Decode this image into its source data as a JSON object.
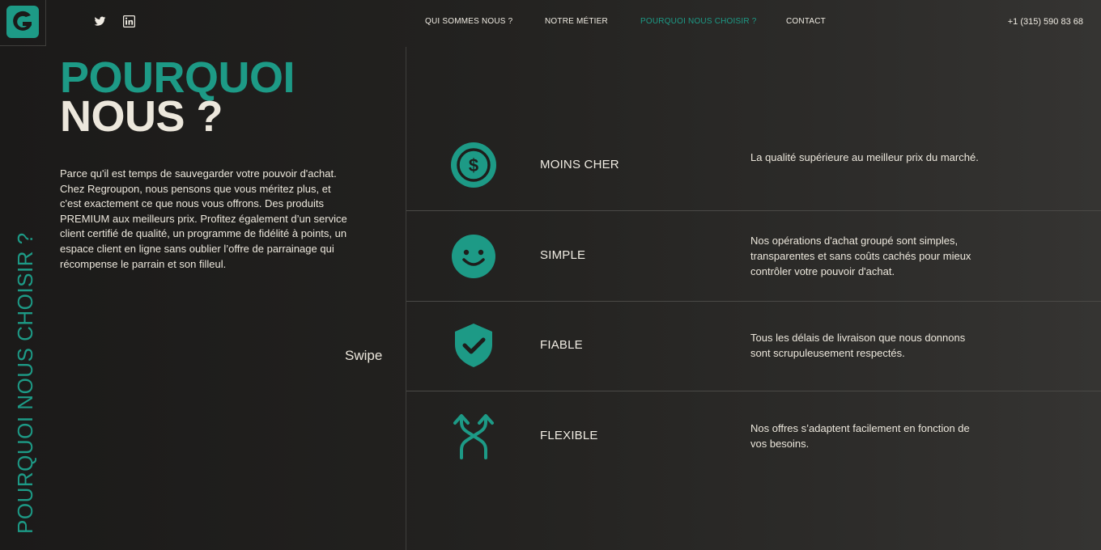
{
  "brand": {
    "logo_icon": "g-logo-icon",
    "accent_color": "#1d9a86"
  },
  "social": [
    {
      "icon": "twitter-icon"
    },
    {
      "icon": "linkedin-icon"
    }
  ],
  "nav": {
    "items": [
      {
        "label": "QUI SOMMES NOUS ?"
      },
      {
        "label": "NOTRE MÉTIER"
      },
      {
        "label": "POURQUOI NOUS CHOISIR ?",
        "active": true
      },
      {
        "label": "CONTACT"
      }
    ],
    "phone": "+1 (315) 590 83 68"
  },
  "side": {
    "vertical_title": "POURQUOI NOUS CHOISIR ?"
  },
  "hero": {
    "title_line1": "POURQUOI",
    "title_line2": "NOUS ?",
    "intro": "Parce qu'il est temps de sauvegarder votre pouvoir d'achat. Chez Regroupon, nous pensons que vous méritez plus, et c'est exactement ce que nous vous offrons. Des produits PREMIUM aux meilleurs prix. Profitez également d’un service client certifié de qualité, un programme de fidélité à points, un espace client en ligne sans oublier l’offre de parrainage qui récompense le parrain et son filleul.",
    "swipe": "Swipe"
  },
  "features": [
    {
      "icon": "dollar-coin-icon",
      "title": "MOINS CHER",
      "desc": "La qualité supérieure au meilleur prix du marché."
    },
    {
      "icon": "smiley-icon",
      "title": "SIMPLE",
      "desc": "Nos opérations d'achat groupé sont simples, transparentes et sans coûts cachés pour mieux contrôler votre pouvoir d'achat."
    },
    {
      "icon": "shield-check-icon",
      "title": "FIABLE",
      "desc": "Tous les délais de livraison que nous donnons sont scrupuleusement respectés."
    },
    {
      "icon": "flexible-arrows-icon",
      "title": "FLEXIBLE",
      "desc": "Nos offres s’adaptent facilement en fonction de vos besoins."
    }
  ]
}
